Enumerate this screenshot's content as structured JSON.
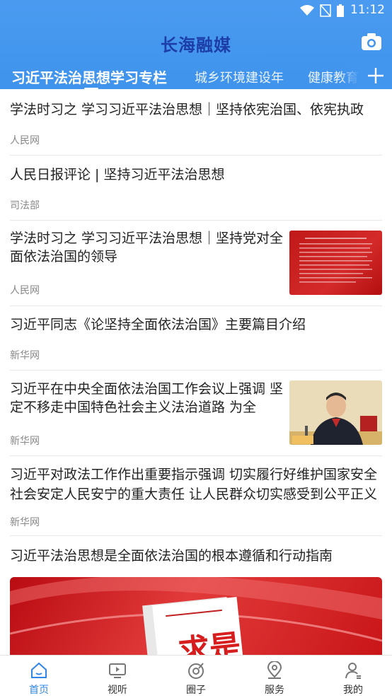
{
  "status_bar": {
    "time": "11:12"
  },
  "header": {
    "title": "长海融媒"
  },
  "tabs": [
    {
      "label": "习近平法治思想学习专栏",
      "active": true
    },
    {
      "label": "城乡环境建设年",
      "active": false
    },
    {
      "label": "健康教育",
      "active": false
    }
  ],
  "articles": [
    {
      "title": "学法时习之 学习习近平法治思想｜坚持依宪治国、依宪执政",
      "source": "人民网"
    },
    {
      "title": "人民日报评论 | 坚持习近平法治思想",
      "source": "司法部"
    },
    {
      "title": "学法时习之 学习习近平法治思想｜坚持党对全面依法治国的领导",
      "source": "人民网"
    },
    {
      "title": "习近平同志《论坚持全面依法治国》主要篇目介绍",
      "source": "新华网"
    },
    {
      "title": "习近平在中央全面依法治国工作会议上强调 坚定不移走中国特色社会主义法治道路 为全",
      "source": "新华网"
    },
    {
      "title_line1": "习近平对政法工作作出重要指示强调 切实履行好维护国家安全",
      "title_line2": "社会安定人民安宁的重大责任 让人民群众切实感受到公平正义",
      "source": "新华网"
    },
    {
      "title": "习近平法治思想是全面依法治国的根本遵循和行动指南",
      "banner_text": "求是"
    }
  ],
  "bottom_nav": [
    {
      "label": "首页",
      "icon": "home-icon",
      "active": true
    },
    {
      "label": "视听",
      "icon": "video-icon",
      "active": false
    },
    {
      "label": "圈子",
      "icon": "circle-icon",
      "active": false
    },
    {
      "label": "服务",
      "icon": "location-icon",
      "active": false
    },
    {
      "label": "我的",
      "icon": "profile-icon",
      "active": false
    }
  ],
  "colors": {
    "accent": "#2f86e8",
    "header": "#4396ee",
    "brand_title": "#1d3ea8"
  }
}
